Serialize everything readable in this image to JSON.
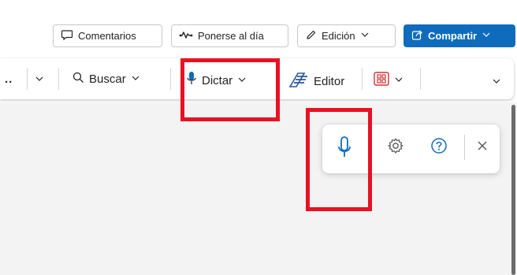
{
  "header": {
    "comments_label": "Comentarios",
    "catchup_label": "Ponerse al día",
    "edit_label": "Edición",
    "share_label": "Compartir"
  },
  "ribbon": {
    "overflow_label": "..",
    "search_label": "Buscar",
    "dictate_label": "Dictar",
    "editor_label": "Editor"
  },
  "dictation_toolbar": {
    "buttons": [
      "microphone",
      "settings",
      "help",
      "close"
    ]
  },
  "colors": {
    "accent": "#0f6cbd",
    "highlight": "#e81123",
    "editor_icon": "#2b5797",
    "addins_icon": "#d13438"
  },
  "icons": [
    "comment-icon",
    "catchup-icon",
    "pencil-icon",
    "share-icon",
    "search-icon",
    "microphone-icon",
    "editor-icon",
    "addins-icon",
    "gear-icon",
    "help-icon",
    "close-icon",
    "chevron-down-icon"
  ]
}
